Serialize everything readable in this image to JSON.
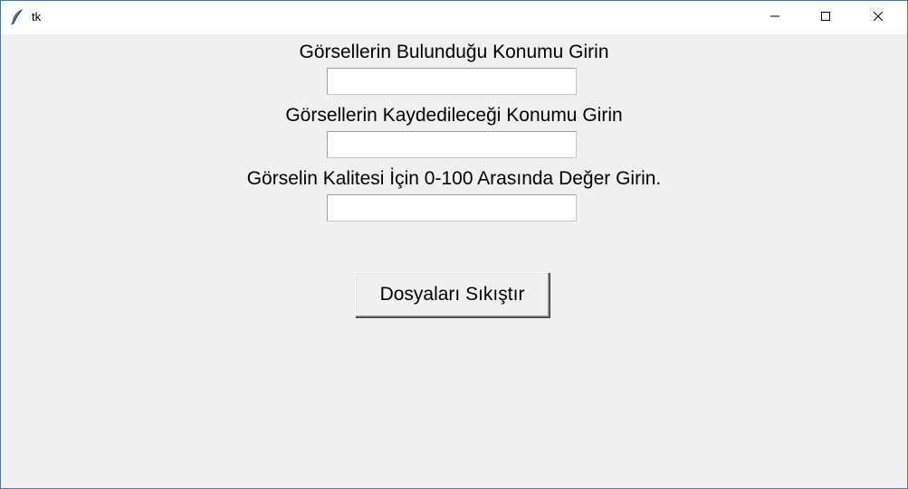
{
  "window": {
    "title": "tk",
    "controls": {
      "minimize_icon": "minimize-icon",
      "maximize_icon": "maximize-icon",
      "close_icon": "close-icon"
    }
  },
  "form": {
    "source_label": "Görsellerin Bulunduğu Konumu Girin",
    "source_value": "",
    "target_label": "Görsellerin Kaydedileceği Konumu Girin",
    "target_value": "",
    "quality_label": "Görselin Kalitesi İçin 0-100 Arasında Değer Girin.",
    "quality_value": "",
    "compress_button": "Dosyaları Sıkıştır"
  },
  "colors": {
    "background": "#f0f0f0",
    "titlebar": "#ffffff",
    "entry": "#ffffff"
  }
}
